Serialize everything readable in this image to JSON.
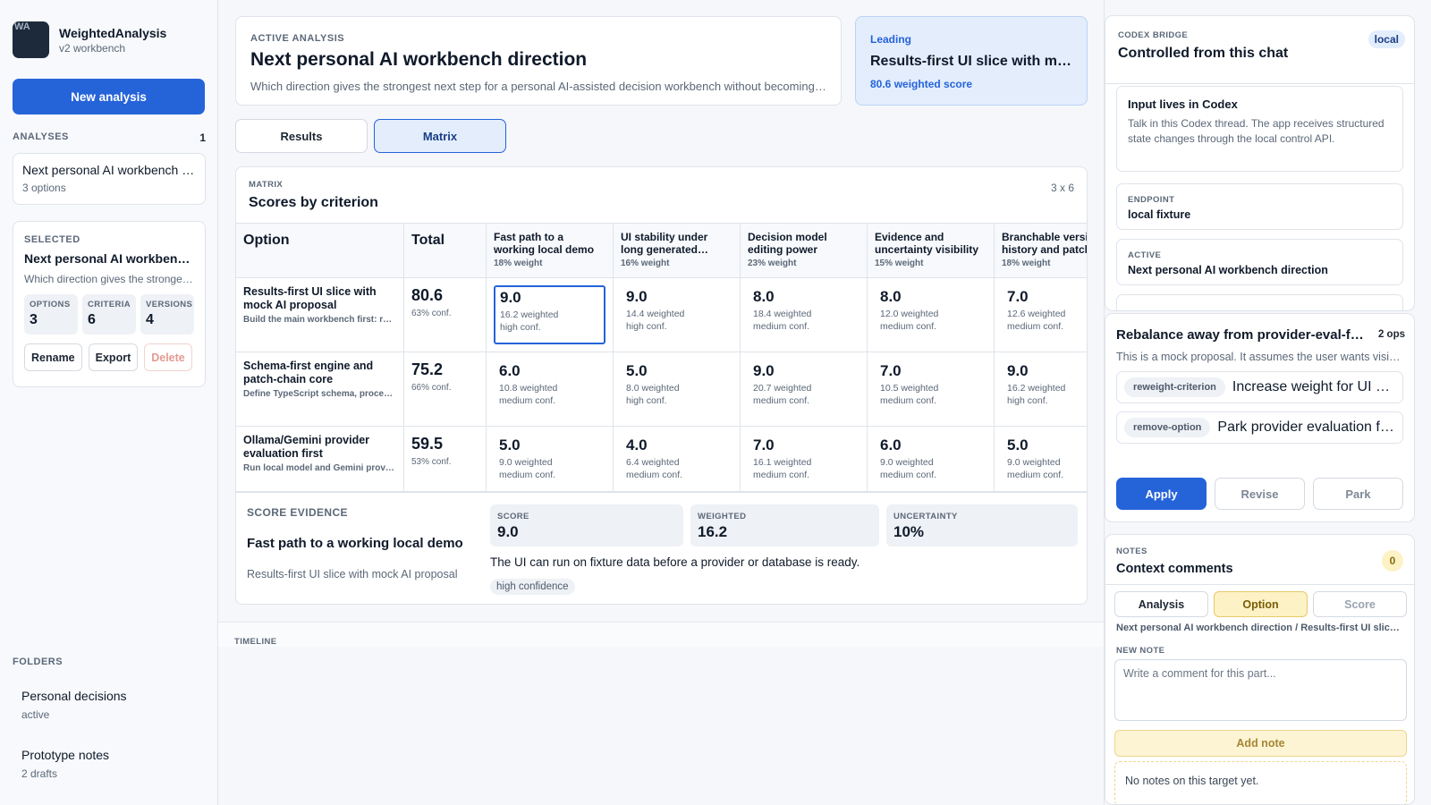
{
  "app": {
    "logo_text": "WA",
    "name": "WeightedAnalysis",
    "subtitle": "v2 workbench"
  },
  "sidebar": {
    "new_button": "New analysis",
    "analyses_label": "ANALYSES",
    "analyses_count": "1",
    "analysis_item": {
      "title": "Next personal AI workbench direction",
      "sub": "3 options"
    },
    "selected": {
      "label": "SELECTED",
      "title": "Next personal AI workbench direction",
      "desc": "Which direction gives the strongest next step for a personal AI-assisted decision workbench",
      "stats": [
        {
          "label": "OPTIONS",
          "value": "3"
        },
        {
          "label": "CRITERIA",
          "value": "6"
        },
        {
          "label": "VERSIONS",
          "value": "4"
        }
      ],
      "rename": "Rename",
      "export": "Export",
      "delete": "Delete"
    },
    "folders_label": "FOLDERS",
    "folders": [
      {
        "title": "Personal decisions",
        "sub": "active"
      },
      {
        "title": "Prototype notes",
        "sub": "2 drafts"
      }
    ]
  },
  "header": {
    "cap": "ACTIVE ANALYSIS",
    "title": "Next personal AI workbench direction",
    "desc": "Which direction gives the strongest next step for a personal AI-assisted decision workbench without becoming a generic chat"
  },
  "leading": {
    "cap": "Leading",
    "title": "Results-first UI slice with mock AI proposal",
    "score": "80.6 weighted score"
  },
  "tabs": {
    "results": "Results",
    "matrix": "Matrix"
  },
  "matrix": {
    "cap": "MATRIX",
    "title": "Scores by criterion",
    "dims": "3 x 6",
    "col_option": "Option",
    "col_total": "Total",
    "criteria": [
      {
        "name": "Fast path to a working local demo",
        "weight": "18% weight"
      },
      {
        "name": "UI stability under long generated content",
        "weight": "16% weight"
      },
      {
        "name": "Decision model editing power",
        "weight": "23% weight"
      },
      {
        "name": "Evidence and uncertainty visibility",
        "weight": "15% weight"
      },
      {
        "name": "Branchable version history and patches",
        "weight": "18% weight"
      }
    ],
    "rows": [
      {
        "name": "Results-first UI slice with mock AI proposal",
        "desc": "Build the main workbench first: results view, matrix and mock proposals",
        "total": "80.6",
        "conf": "63% conf.",
        "scores": [
          {
            "v": "9.0",
            "w": "16.2 weighted",
            "c": "high conf."
          },
          {
            "v": "9.0",
            "w": "14.4 weighted",
            "c": "high conf."
          },
          {
            "v": "8.0",
            "w": "18.4 weighted",
            "c": "medium conf."
          },
          {
            "v": "8.0",
            "w": "12.0 weighted",
            "c": "medium conf."
          },
          {
            "v": "7.0",
            "w": "12.6 weighted",
            "c": "medium conf."
          }
        ]
      },
      {
        "name": "Schema-first engine and patch-chain core",
        "desc": "Define TypeScript schema, process and patch chain before UI",
        "total": "75.2",
        "conf": "66% conf.",
        "scores": [
          {
            "v": "6.0",
            "w": "10.8 weighted",
            "c": "medium conf."
          },
          {
            "v": "5.0",
            "w": "8.0 weighted",
            "c": "high conf."
          },
          {
            "v": "9.0",
            "w": "20.7 weighted",
            "c": "medium conf."
          },
          {
            "v": "7.0",
            "w": "10.5 weighted",
            "c": "medium conf."
          },
          {
            "v": "9.0",
            "w": "16.2 weighted",
            "c": "high conf."
          }
        ]
      },
      {
        "name": "Ollama/Gemini provider evaluation first",
        "desc": "Run local model and Gemini provider comparisons first",
        "total": "59.5",
        "conf": "53% conf.",
        "scores": [
          {
            "v": "5.0",
            "w": "9.0 weighted",
            "c": "medium conf."
          },
          {
            "v": "4.0",
            "w": "6.4 weighted",
            "c": "medium conf."
          },
          {
            "v": "7.0",
            "w": "16.1 weighted",
            "c": "medium conf."
          },
          {
            "v": "6.0",
            "w": "9.0 weighted",
            "c": "medium conf."
          },
          {
            "v": "5.0",
            "w": "9.0 weighted",
            "c": "medium conf."
          }
        ]
      }
    ]
  },
  "evidence": {
    "cap": "SCORE EVIDENCE",
    "criterion": "Fast path to a working local demo",
    "option": "Results-first UI slice with mock AI proposal",
    "score_label": "SCORE",
    "score": "9.0",
    "weighted_label": "WEIGHTED",
    "weighted": "16.2",
    "uncertainty_label": "UNCERTAINTY",
    "uncertainty": "10%",
    "text": "The UI can run on fixture data before a provider or database is ready.",
    "tag": "high confidence"
  },
  "timeline": {
    "label": "TIMELINE"
  },
  "codex": {
    "cap": "CODEX BRIDGE",
    "title": "Controlled from this chat",
    "badge": "local",
    "input_title": "Input lives in Codex",
    "input_desc": "Talk in this Codex thread. The app receives structured state changes through the local control API.",
    "endpoint_label": "ENDPOINT",
    "endpoint": "local fixture",
    "active_label": "ACTIVE",
    "active": "Next personal AI workbench direction"
  },
  "proposal": {
    "title": "Rebalance away from provider-eval-first",
    "ops": "2 ops",
    "desc": "This is a mock proposal. It assumes the user wants visible results first",
    "operations": [
      {
        "tag": "reweight-criterion",
        "text": "Increase weight for UI stability"
      },
      {
        "tag": "remove-option",
        "text": "Park provider evaluation first"
      }
    ],
    "apply": "Apply",
    "revise": "Revise",
    "park": "Park"
  },
  "notes": {
    "cap": "NOTES",
    "title": "Context comments",
    "count": "0",
    "tabs": [
      "Analysis",
      "Option",
      "Score"
    ],
    "path": "Next personal AI workbench direction / Results-first UI slice with mock AI proposal",
    "new_label": "NEW NOTE",
    "placeholder": "Write a comment for this part...",
    "add": "Add note",
    "empty": "No notes on this target yet."
  },
  "colors": {
    "accent": "#2563d9",
    "leading_bg": "#e3edfc",
    "note_yellow": "#fdf2c6",
    "logo_bg": "#1c2a3b"
  }
}
